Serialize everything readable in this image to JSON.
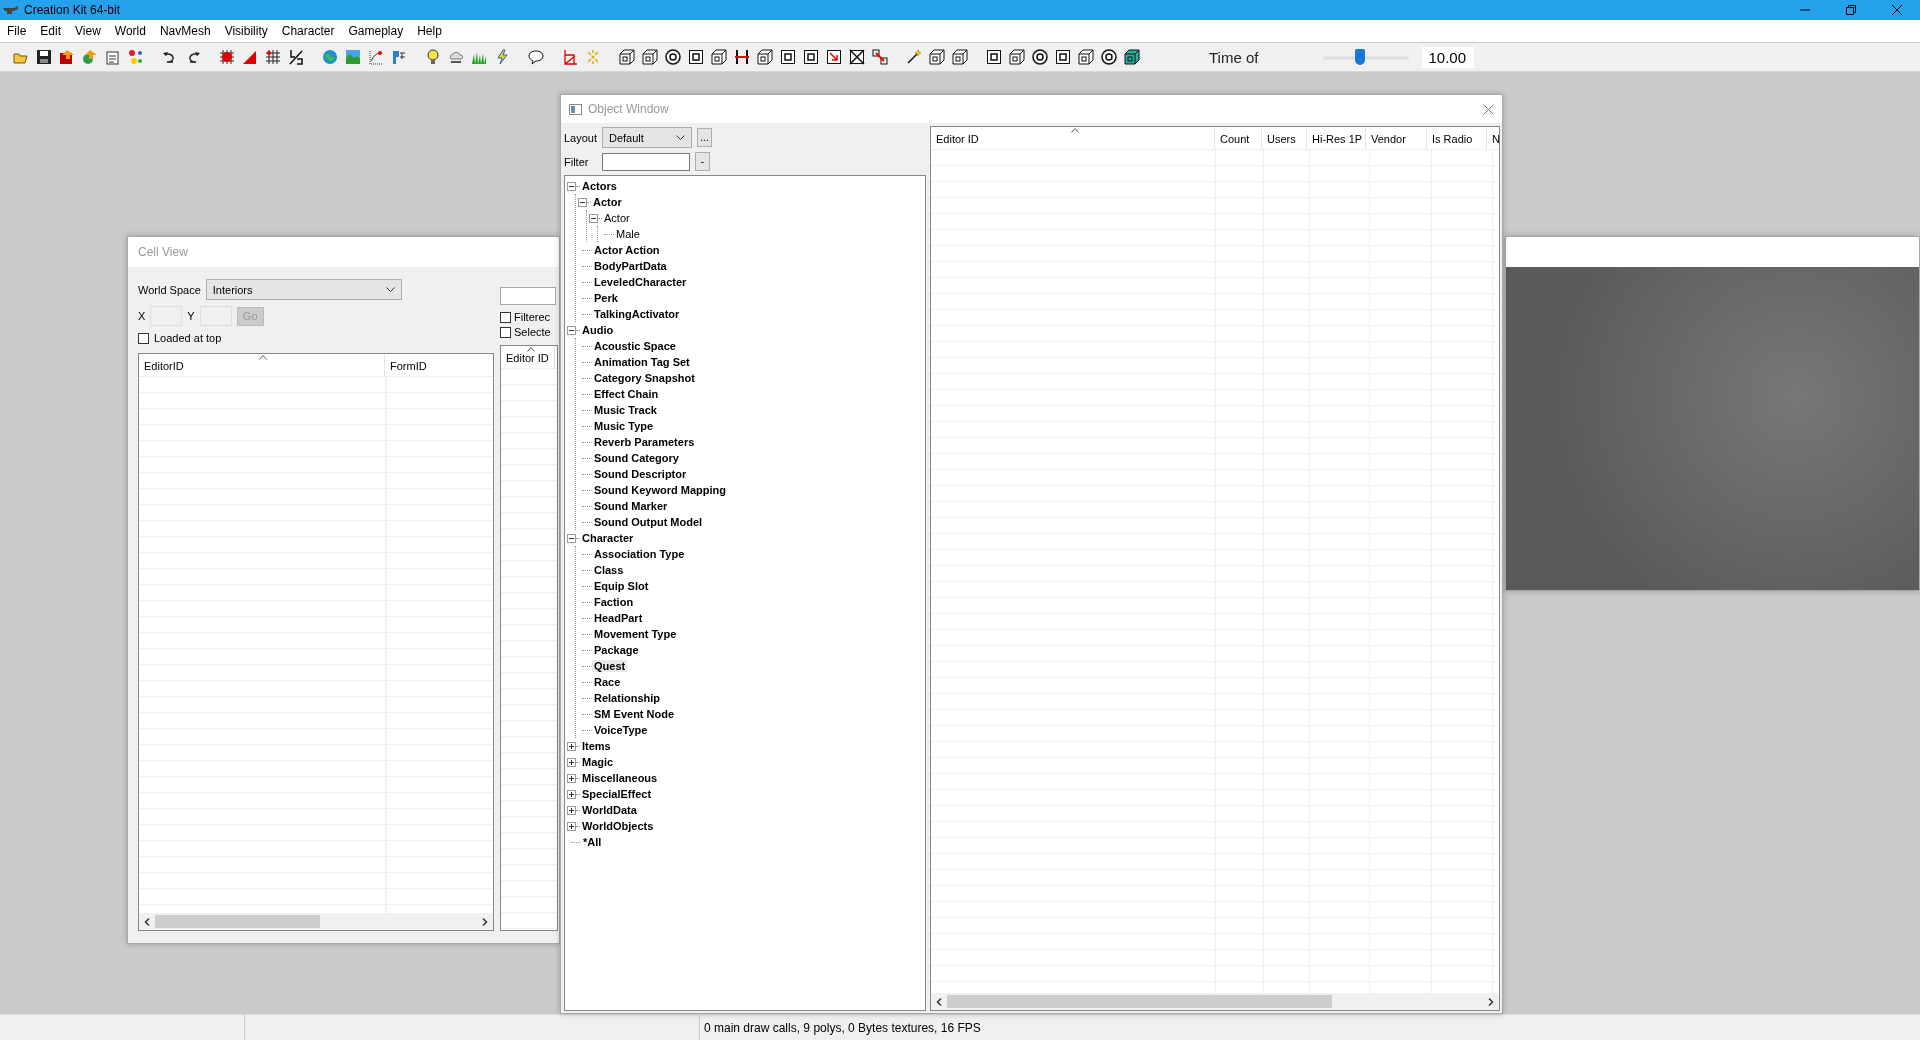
{
  "window": {
    "title": "Creation Kit 64-bit"
  },
  "menu": [
    "File",
    "Edit",
    "View",
    "World",
    "NavMesh",
    "Visibility",
    "Character",
    "Gameplay",
    "Help"
  ],
  "toolbar": {
    "time_label": "Time of",
    "time_slider": {
      "level": 0.43
    },
    "time_value": "10.00"
  },
  "cell_view": {
    "title": "Cell View",
    "world_space_label": "World Space",
    "world_space_value": "Interiors",
    "x_label": "X",
    "y_label": "Y",
    "go_button": {
      "label": "Go",
      "disabled": true
    },
    "loaded_at_top": {
      "label": "Loaded at top",
      "checked": false
    },
    "columns": [
      "EditorID",
      "FormID"
    ],
    "options": [
      {
        "label": "Filterec",
        "checked": false
      },
      {
        "label": "Selecte",
        "checked": false
      }
    ],
    "side_columns": [
      "Editor ID"
    ]
  },
  "object_window": {
    "title": "Object Window",
    "layout_label": "Layout",
    "layout_value": "Default",
    "layout_more": "...",
    "filter_label": "Filter",
    "filter_clear": "-",
    "tree": [
      {
        "label": "Actors",
        "bold": true,
        "selected": false,
        "expanded": true,
        "children": [
          {
            "label": "Actor",
            "bold": true,
            "selected": false,
            "expanded": true,
            "children": [
              {
                "label": "Actor",
                "bold": false,
                "selected": false,
                "expanded": true,
                "children": [
                  {
                    "label": "Male",
                    "bold": false,
                    "selected": false
                  }
                ]
              }
            ]
          },
          {
            "label": "Actor Action",
            "bold": true,
            "selected": false
          },
          {
            "label": "BodyPartData",
            "bold": true,
            "selected": false
          },
          {
            "label": "LeveledCharacter",
            "bold": true,
            "selected": false
          },
          {
            "label": "Perk",
            "bold": true,
            "selected": false
          },
          {
            "label": "TalkingActivator",
            "bold": true,
            "selected": false
          }
        ]
      },
      {
        "label": "Audio",
        "bold": true,
        "selected": false,
        "expanded": true,
        "children": [
          {
            "label": "Acoustic Space",
            "bold": true,
            "selected": false
          },
          {
            "label": "Animation Tag Set",
            "bold": true,
            "selected": false
          },
          {
            "label": "Category Snapshot",
            "bold": true,
            "selected": false
          },
          {
            "label": "Effect Chain",
            "bold": true,
            "selected": false
          },
          {
            "label": "Music Track",
            "bold": true,
            "selected": false
          },
          {
            "label": "Music Type",
            "bold": true,
            "selected": false
          },
          {
            "label": "Reverb Parameters",
            "bold": true,
            "selected": false
          },
          {
            "label": "Sound Category",
            "bold": true,
            "selected": false
          },
          {
            "label": "Sound Descriptor",
            "bold": true,
            "selected": false
          },
          {
            "label": "Sound Keyword Mapping",
            "bold": true,
            "selected": false
          },
          {
            "label": "Sound Marker",
            "bold": true,
            "selected": false
          },
          {
            "label": "Sound Output Model",
            "bold": true,
            "selected": false
          }
        ]
      },
      {
        "label": "Character",
        "bold": true,
        "selected": false,
        "expanded": true,
        "children": [
          {
            "label": "Association Type",
            "bold": true,
            "selected": false
          },
          {
            "label": "Class",
            "bold": true,
            "selected": false
          },
          {
            "label": "Equip Slot",
            "bold": true,
            "selected": false
          },
          {
            "label": "Faction",
            "bold": true,
            "selected": false
          },
          {
            "label": "HeadPart",
            "bold": true,
            "selected": false
          },
          {
            "label": "Movement Type",
            "bold": true,
            "selected": false
          },
          {
            "label": "Package",
            "bold": true,
            "selected": false
          },
          {
            "label": "Quest",
            "bold": true,
            "selected": true
          },
          {
            "label": "Race",
            "bold": true,
            "selected": false
          },
          {
            "label": "Relationship",
            "bold": true,
            "selected": false
          },
          {
            "label": "SM Event Node",
            "bold": true,
            "selected": false
          },
          {
            "label": "VoiceType",
            "bold": true,
            "selected": false
          }
        ]
      },
      {
        "label": "Items",
        "bold": true,
        "selected": false,
        "expanded": false
      },
      {
        "label": "Magic",
        "bold": true,
        "selected": false,
        "expanded": false
      },
      {
        "label": "Miscellaneous",
        "bold": true,
        "selected": false,
        "expanded": false
      },
      {
        "label": "SpecialEffect",
        "bold": true,
        "selected": false,
        "expanded": false
      },
      {
        "label": "WorldData",
        "bold": true,
        "selected": false,
        "expanded": false
      },
      {
        "label": "WorldObjects",
        "bold": true,
        "selected": false,
        "expanded": false
      },
      {
        "label": "*All",
        "bold": true,
        "selected": false
      }
    ],
    "columns": [
      "Editor ID",
      "Count",
      "Users",
      "Hi-Res 1P",
      "Vendor",
      "Is Radio",
      "N"
    ]
  },
  "status_bar": {
    "text": "0 main draw calls, 9 polys, 0 Bytes textures, 16 FPS"
  }
}
